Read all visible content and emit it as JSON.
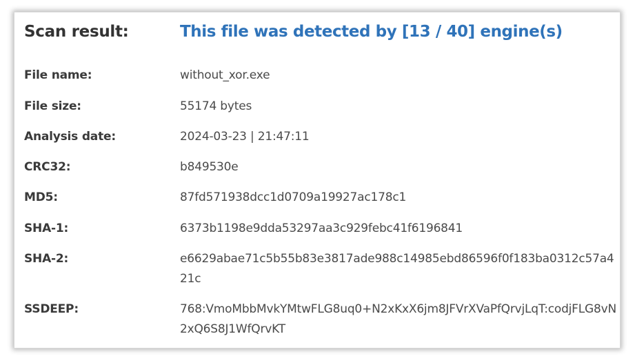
{
  "scan_result": {
    "label": "Scan result:",
    "value": "This file was detected by [13 / 40] engine(s)"
  },
  "details": {
    "file_name": {
      "label": "File name:",
      "value": "without_xor.exe"
    },
    "file_size": {
      "label": "File size:",
      "value": "55174 bytes"
    },
    "analysis_date": {
      "label": "Analysis date:",
      "value": "2024-03-23 | 21:47:11"
    },
    "crc32": {
      "label": "CRC32:",
      "value": "b849530e"
    },
    "md5": {
      "label": "MD5:",
      "value": "87fd571938dcc1d0709a19927ac178c1"
    },
    "sha1": {
      "label": "SHA-1:",
      "value": "6373b1198e9dda53297aa3c929febc41f6196841"
    },
    "sha2": {
      "label": "SHA-2:",
      "value": "e6629abae71c5b55b83e3817ade988c14985ebd86596f0f183ba0312c57a421c"
    },
    "ssdeep": {
      "label": "SSDEEP:",
      "value": "768:VmoMbbMvkYMtwFLG8uq0+N2xKxX6jm8JFVrXVaPfQrvjLqT:codjFLG8vN2xQ6S8J1WfQrvKT"
    }
  },
  "colors": {
    "detection_text": "#2f73b9",
    "label_text": "#3a3a3a",
    "value_text": "#4a4a4a"
  }
}
